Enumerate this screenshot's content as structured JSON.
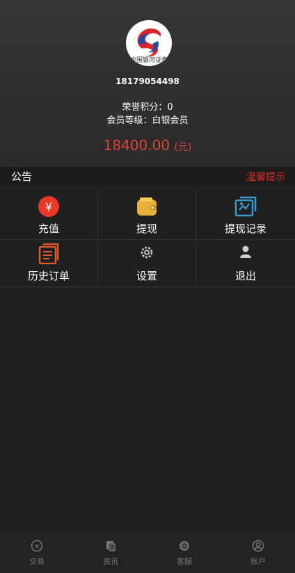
{
  "profile": {
    "avatar_text": "中国银河证券",
    "phone": "18179054498",
    "points_label": "荣誉积分：",
    "points_value": "0",
    "level_label": "会员等级：",
    "level_value": "白银会员",
    "balance": "18400.00",
    "balance_unit": "(元)"
  },
  "notice": {
    "label": "公告",
    "marquee": "温馨提示"
  },
  "menu": [
    {
      "label": "充值",
      "icon": "recharge-icon",
      "color": "#e8392b"
    },
    {
      "label": "提现",
      "icon": "wallet-icon",
      "color": "#e8b23a"
    },
    {
      "label": "提现记录",
      "icon": "withdraw-record-icon",
      "color": "#3a9ad0"
    },
    {
      "label": "历史订单",
      "icon": "order-history-icon",
      "color": "#e05a2b"
    },
    {
      "label": "设置",
      "icon": "gear-icon",
      "color": "#cfcfcf"
    },
    {
      "label": "退出",
      "icon": "user-icon",
      "color": "#cfcfcf"
    }
  ],
  "tabs": [
    {
      "label": "交易",
      "icon": "trade-icon"
    },
    {
      "label": "资讯",
      "icon": "news-icon"
    },
    {
      "label": "客服",
      "icon": "service-icon"
    },
    {
      "label": "账户",
      "icon": "account-icon"
    }
  ],
  "colors": {
    "accent_red": "#e0453a",
    "background": "#202020",
    "tab_inactive": "#777777"
  }
}
